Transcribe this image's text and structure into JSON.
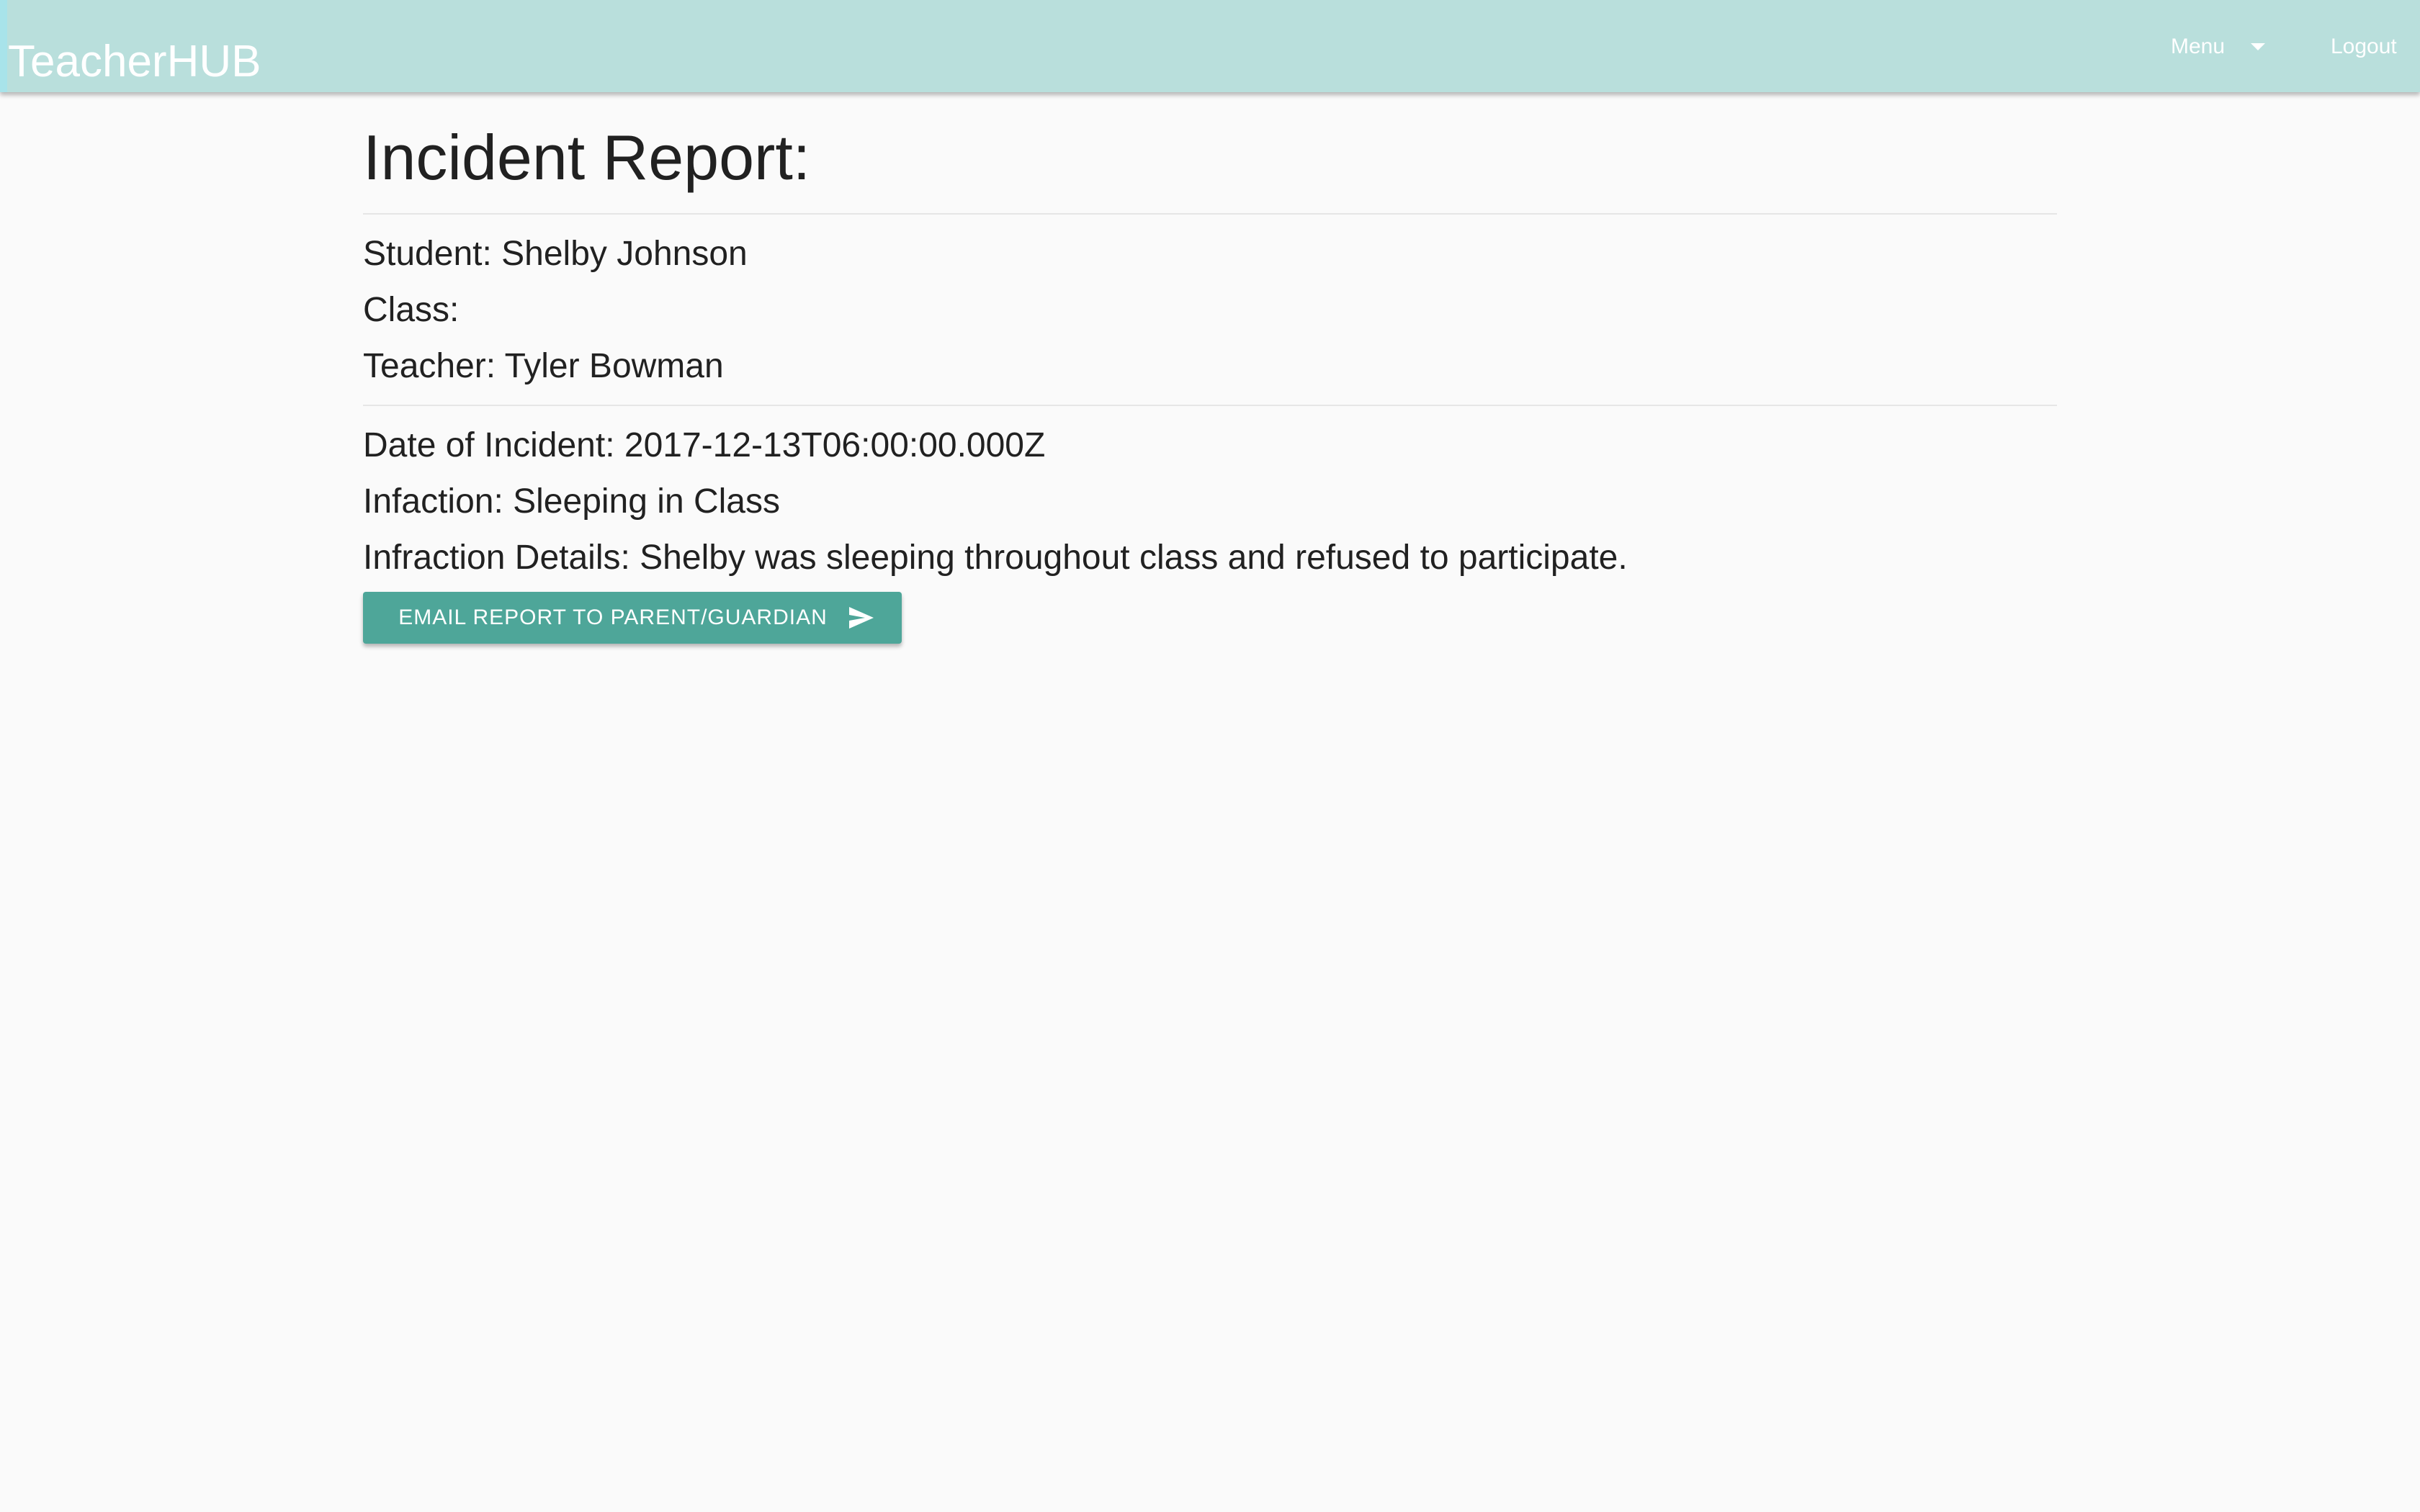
{
  "header": {
    "brand": "TeacherHUB",
    "menu_label": "Menu",
    "logout_label": "Logout",
    "background_color": "#b9dfdc",
    "menu_icon": "chevron-down-icon"
  },
  "report": {
    "title": "Incident Report:",
    "student": "Student: Shelby Johnson",
    "class": "Class:",
    "teacher": "Teacher: Tyler Bowman",
    "date": "Date of Incident: 2017-12-13T06:00:00.000Z",
    "infraction": "Infaction: Sleeping in Class",
    "details": "Infraction Details: Shelby was sleeping throughout class and refused to participate.",
    "email_button": "EMAIL REPORT TO PARENT/GUARDIAN",
    "email_button_color": "#4ea699",
    "email_button_icon": "send-icon"
  }
}
